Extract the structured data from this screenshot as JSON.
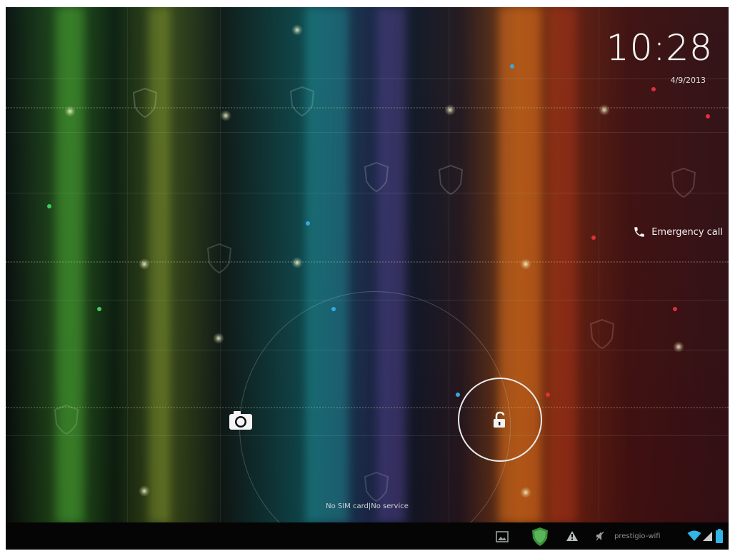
{
  "lockscreen": {
    "time": "10:28",
    "date": "4/9/2013",
    "emergency_label": "Emergency call",
    "carrier_status": "No SIM card|No service"
  },
  "status_bar": {
    "wifi_name": "prestigio-wifi",
    "icons": [
      "image-icon",
      "shield-icon",
      "warning-icon",
      "volume-muted-icon",
      "wifi-icon",
      "signal-icon",
      "battery-icon"
    ]
  },
  "colors": {
    "text": "#f2f4f4",
    "status_bar_bg": "#050505",
    "accent_green": "#3a8f3a",
    "accent_blue": "#33b5e5"
  }
}
